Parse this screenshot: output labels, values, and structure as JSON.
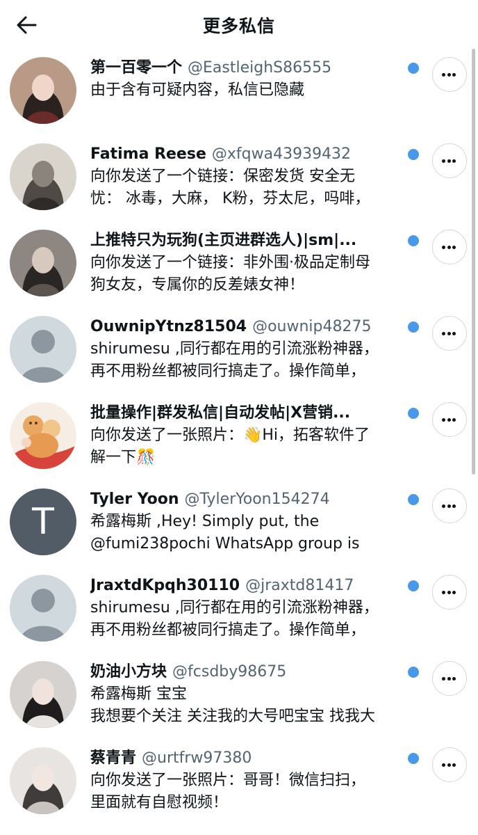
{
  "header": {
    "title": "更多私信",
    "back_icon": "arrow-left-icon"
  },
  "conversations": [
    {
      "name": "第一百零一个",
      "handle": "@EastleighS86555",
      "lines": [
        "由于含有可疑内容，私信已隐藏"
      ],
      "unread": true,
      "avatar_type": "photo"
    },
    {
      "name": "Fatima Reese",
      "handle": "@xfqwa43939432",
      "lines": [
        "向你发送了一个链接：保密发货 安全无",
        "忧： 冰毒，大麻， K粉，芬太尼，吗啡，"
      ],
      "unread": true,
      "avatar_type": "photo"
    },
    {
      "name": "上推特只为玩狗(主页进群选人)|sm|...",
      "handle": "",
      "lines": [
        "向你发送了一个链接：非外围·极品定制母",
        "狗女友，专属你的反差婊女神！"
      ],
      "unread": true,
      "avatar_type": "photo"
    },
    {
      "name": "OuwnipYtnz81504",
      "handle": "@ouwnip48275",
      "lines": [
        "shirumesu ,同行都在用的引流涨粉神器，",
        "再不用粉丝都被同行搞走了。操作简单，"
      ],
      "unread": true,
      "avatar_type": "default"
    },
    {
      "name": "批量操作|群发私信|自动发帖|X营销...",
      "handle": "",
      "lines": [
        "向你发送了一张照片：👋Hi，拓客软件了",
        "解一下🎊"
      ],
      "unread": true,
      "avatar_type": "illustration"
    },
    {
      "name": "Tyler Yoon",
      "handle": "@TylerYoon154274",
      "lines": [
        "希露梅斯 ,Hey! Simply put, the",
        "@fumi238pochi WhatsApp group is"
      ],
      "unread": true,
      "avatar_type": "initial",
      "avatar_initial": "T"
    },
    {
      "name": "JraxtdKpqh30110",
      "handle": "@jraxtd81417",
      "lines": [
        "shirumesu ,同行都在用的引流涨粉神器，",
        "再不用粉丝都被同行搞走了。操作简单，"
      ],
      "unread": true,
      "avatar_type": "default"
    },
    {
      "name": "奶油小方块",
      "handle": "@fcsdby98675",
      "lines": [
        "希露梅斯 宝宝",
        "我想要个关注 关注我的大号吧宝宝 找我大"
      ],
      "unread": true,
      "avatar_type": "photo"
    },
    {
      "name": "蔡青青",
      "handle": "@urtfrw97380",
      "lines": [
        "向你发送了一张照片：哥哥！微信扫扫，",
        "里面就有自慰视频！"
      ],
      "unread": true,
      "avatar_type": "photo"
    }
  ],
  "colors": {
    "accent": "#4a99e9",
    "secondary_text": "#536471",
    "default_avatar_bg": "#cfd9de",
    "default_avatar_fg": "#8c97a0",
    "initial_avatar_bg": "#525c66"
  },
  "icons": {
    "more": "more-horizontal-icon",
    "unread": "unread-dot"
  }
}
